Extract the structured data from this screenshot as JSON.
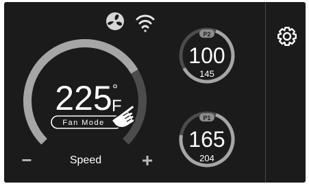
{
  "status_bar": {
    "fan_icon": "fan-icon",
    "wifi_icon": "wifi-icon"
  },
  "main_dial": {
    "temperature": "225",
    "unit_degree": "°",
    "unit_letter": "F",
    "mode_label": "Fan Mode",
    "speed_label": "Speed",
    "minus_label": "−",
    "plus_label": "+",
    "speed_level": 0.72
  },
  "probes": [
    {
      "badge": "P2",
      "current": "100",
      "target": "145",
      "progress": 0.69
    },
    {
      "badge": "P1",
      "current": "165",
      "target": "204",
      "progress": 0.81
    }
  ],
  "side_panel": {
    "settings_icon": "gear-icon"
  },
  "overlay": {
    "hand_icon": "pointing-hand-icon"
  },
  "colors": {
    "background": "#1b1b1b",
    "ring_track": "#4c4c4c",
    "ring_active": "#a6a6a6",
    "text_primary": "#ffffff",
    "text_secondary": "#b8b8b8"
  }
}
